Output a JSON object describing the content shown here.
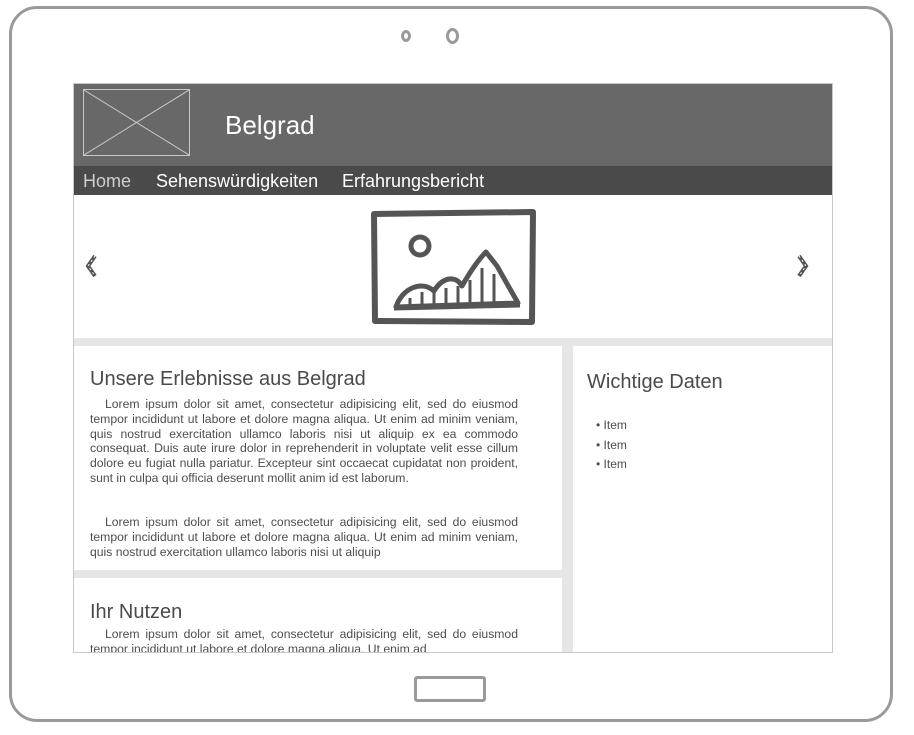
{
  "header": {
    "title": "Belgrad"
  },
  "nav": {
    "items": [
      "Home",
      "Sehenswürdigkeiten",
      "Erfahrungsbericht"
    ]
  },
  "carousel": {
    "prev_icon": "chevron-left-icon",
    "next_icon": "chevron-right-icon",
    "image_icon": "image-placeholder-icon"
  },
  "main": {
    "section1": {
      "heading": "Unsere Erlebnisse aus Belgrad",
      "paragraphs": [
        "Lorem ipsum dolor sit amet, consectetur adipisicing elit, sed do eiusmod tempor incididunt ut labore et dolore magna aliqua. Ut enim ad minim veniam, quis nostrud exercitation ullamco laboris nisi ut aliquip ex ea commodo consequat. Duis aute irure dolor in reprehenderit in voluptate velit esse cillum dolore eu fugiat nulla pariatur. Excepteur sint occaecat cupidatat non proident, sunt in culpa qui officia deserunt mollit anim id est laborum.",
        "Lorem ipsum dolor sit amet, consectetur adipisicing elit, sed do eiusmod tempor incididunt ut labore et dolore magna aliqua. Ut enim ad minim veniam, quis nostrud exercitation ullamco laboris nisi ut aliquip"
      ]
    },
    "section2": {
      "heading": "Ihr Nutzen",
      "paragraphs": [
        "Lorem ipsum dolor sit amet, consectetur adipisicing elit, sed do eiusmod tempor incididunt ut labore et dolore magna aliqua. Ut enim ad"
      ]
    }
  },
  "sidebar": {
    "heading": "Wichtige Daten",
    "items": [
      "• Item",
      "• Item",
      "• Item"
    ]
  },
  "colors": {
    "header": "#686868",
    "nav": "#4a4a4a",
    "band": "#e6e6e6",
    "device_frame": "#9a9a9a"
  }
}
